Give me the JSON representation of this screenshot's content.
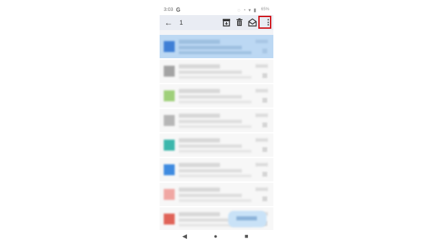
{
  "status_bar": {
    "time": "3:03",
    "g_badge": "G",
    "system_icons": "◌ ◔ ▾ ▮",
    "battery": "65%"
  },
  "app_bar": {
    "back_glyph": "←",
    "selected_count": "1",
    "more_glyph": "⋮"
  },
  "email_rows": [
    {
      "selected": true,
      "avatar_color": "#3f7fd6"
    },
    {
      "selected": false,
      "avatar_color": "#a3a3a3"
    },
    {
      "selected": false,
      "avatar_color": "#9fd07a"
    },
    {
      "selected": false,
      "avatar_color": "#b6b6b6"
    },
    {
      "selected": false,
      "avatar_color": "#3cb7ac"
    },
    {
      "selected": false,
      "avatar_color": "#3f8be0"
    },
    {
      "selected": false,
      "avatar_color": "#f0a7a3"
    },
    {
      "selected": false,
      "avatar_color": "#e06358"
    }
  ],
  "nav_bar": {
    "back_glyph": "◀",
    "home_glyph": "●",
    "recents_glyph": "■"
  },
  "colors": {
    "app_bar_bg": "#e9ecf3",
    "selected_row_bg": "#bcd8f3",
    "highlight_border": "#d0141a"
  }
}
